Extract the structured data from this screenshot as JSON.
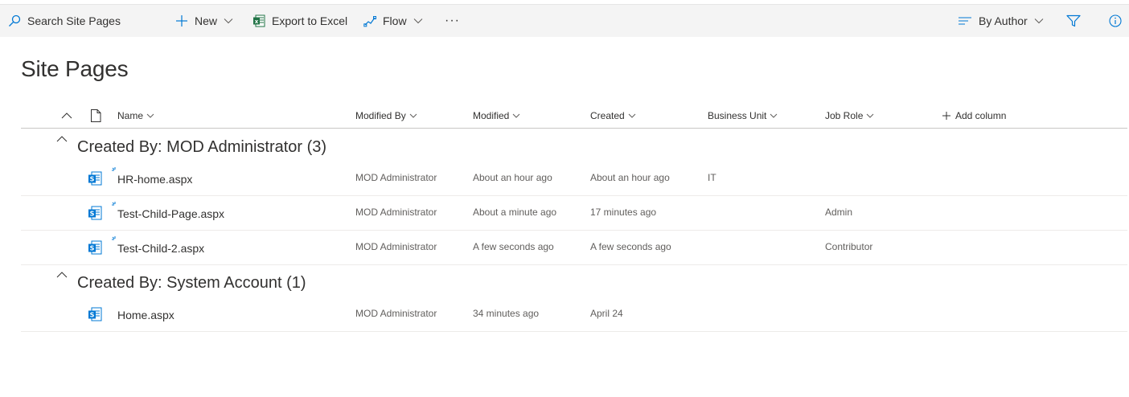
{
  "commandbar": {
    "search_placeholder": "Search Site Pages",
    "new_label": "New",
    "export_label": "Export to Excel",
    "flow_label": "Flow",
    "more_label": "···",
    "view_label": "By Author"
  },
  "page": {
    "title": "Site Pages"
  },
  "columns": {
    "name": "Name",
    "modified_by": "Modified By",
    "modified": "Modified",
    "created": "Created",
    "business_unit": "Business Unit",
    "job_role": "Job Role",
    "add_column": "Add column"
  },
  "groups": [
    {
      "title": "Created By: MOD Administrator (3)",
      "rows": [
        {
          "name": "HR-home.aspx",
          "modified_by": "MOD Administrator",
          "modified": "About an hour ago",
          "created": "About an hour ago",
          "business_unit": "IT",
          "job_role": ""
        },
        {
          "name": "Test-Child-Page.aspx",
          "modified_by": "MOD Administrator",
          "modified": "About a minute ago",
          "created": "17 minutes ago",
          "business_unit": "",
          "job_role": "Admin"
        },
        {
          "name": "Test-Child-2.aspx",
          "modified_by": "MOD Administrator",
          "modified": "A few seconds ago",
          "created": "A few seconds ago",
          "business_unit": "",
          "job_role": "Contributor"
        }
      ]
    },
    {
      "title": "Created By: System Account (1)",
      "rows": [
        {
          "name": "Home.aspx",
          "modified_by": "MOD Administrator",
          "modified": "34 minutes ago",
          "created": "April 24",
          "business_unit": "",
          "job_role": ""
        }
      ]
    }
  ],
  "colors": {
    "accent": "#0078d4",
    "text": "#323130",
    "subtext": "#605e5c",
    "excel": "#217346"
  },
  "icons": [
    "search-icon",
    "plus-icon",
    "excel-icon",
    "flow-icon",
    "more-icon",
    "group-by-icon",
    "filter-icon",
    "info-icon",
    "sharepoint-page-icon",
    "new-item-icon",
    "chevron-up-icon",
    "chevron-down-icon",
    "document-icon"
  ]
}
